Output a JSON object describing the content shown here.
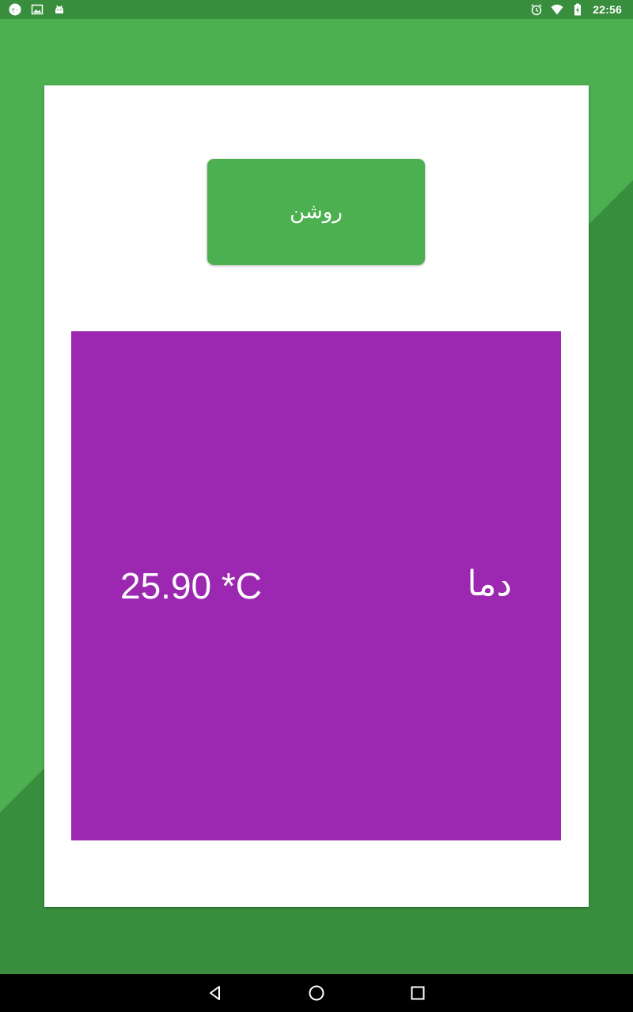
{
  "status_bar": {
    "time": "22:56",
    "left_icons": [
      "notification-badge-icon",
      "image-icon",
      "android-icon"
    ],
    "right_icons": [
      "alarm-icon",
      "wifi-icon",
      "battery-charging-icon"
    ],
    "badge_text": "۲۰",
    "color": "#388e3c"
  },
  "main": {
    "on_button_label": "روشن",
    "temperature": {
      "label": "دما",
      "value": "25.90 *C"
    }
  },
  "colors": {
    "primary": "#4caf50",
    "primary_dark": "#388e3c",
    "panel": "#9c27b0",
    "card": "#ffffff"
  },
  "nav_bar": {
    "buttons": [
      "back-icon",
      "home-icon",
      "recents-icon"
    ]
  }
}
